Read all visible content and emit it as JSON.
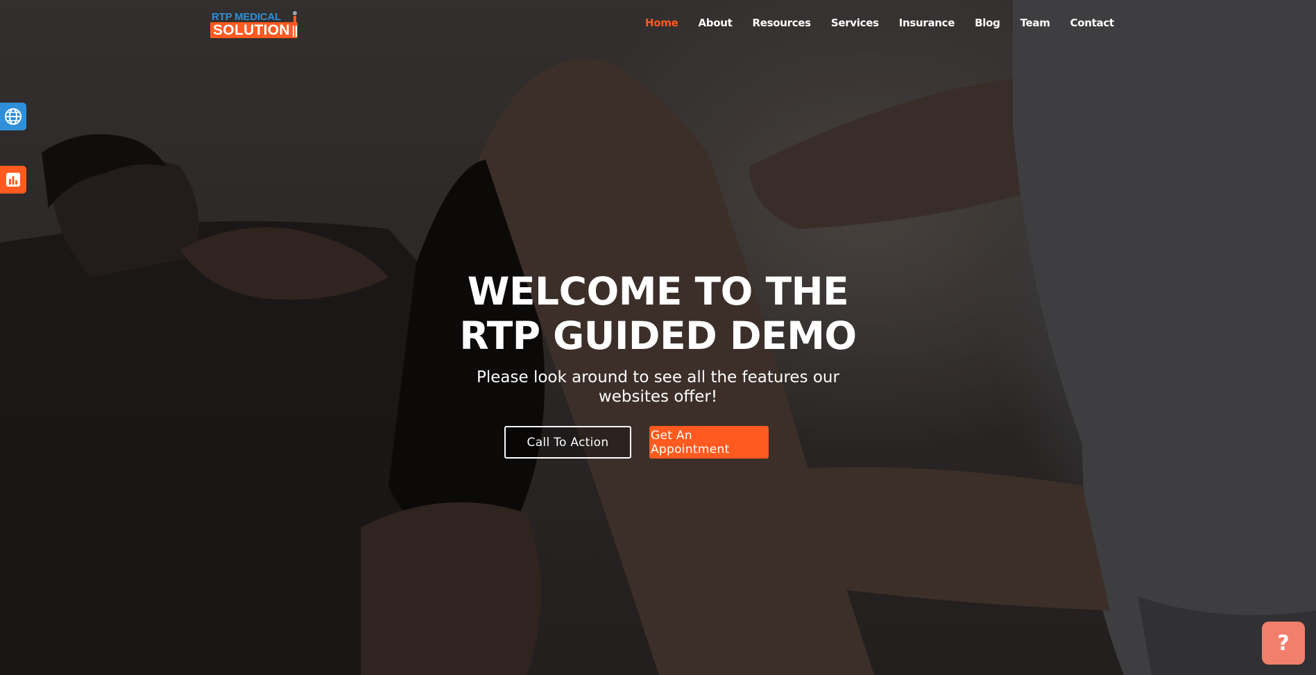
{
  "logo": {
    "top_text": "RTP MEDICAL",
    "bottom_text": "SOLUTION"
  },
  "nav": {
    "items": [
      {
        "label": "Home",
        "active": true
      },
      {
        "label": "About",
        "active": false
      },
      {
        "label": "Resources",
        "active": false
      },
      {
        "label": "Services",
        "active": false
      },
      {
        "label": "Insurance",
        "active": false
      },
      {
        "label": "Blog",
        "active": false
      },
      {
        "label": "Team",
        "active": false
      },
      {
        "label": "Contact",
        "active": false
      }
    ]
  },
  "side_widgets": {
    "globe_icon": "globe-icon",
    "chart_icon": "bar-chart-icon"
  },
  "hero": {
    "title_line1": "WELCOME TO THE",
    "title_line2": "RTP GUIDED DEMO",
    "subtitle": "Please look around to see all the features our websites offer!",
    "cta_label": "Call To Action",
    "appointment_label": "Get An Appointment"
  },
  "help": {
    "label": "?"
  },
  "colors": {
    "accent": "#ff5a1f",
    "brand_blue": "#2f8fd8",
    "help_button": "#f07f6b"
  }
}
